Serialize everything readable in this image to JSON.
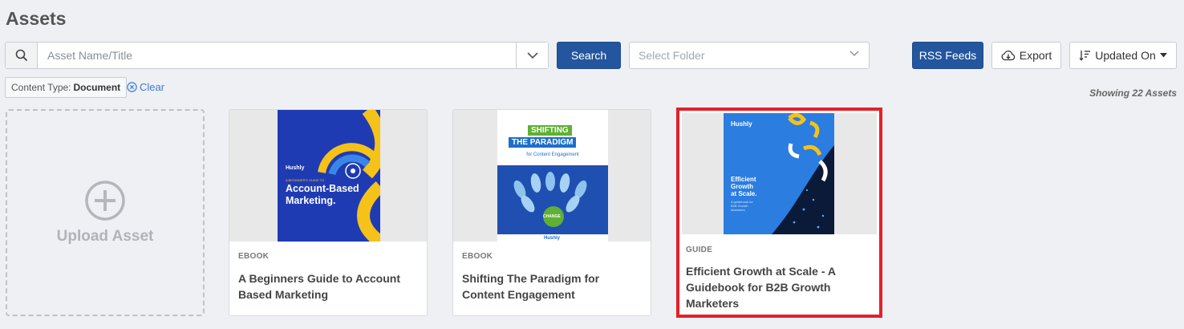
{
  "page": {
    "title": "Assets"
  },
  "search": {
    "placeholder": "Asset Name/Title",
    "button_label": "Search"
  },
  "folder_select": {
    "placeholder": "Select Folder"
  },
  "toolbar": {
    "rss_label": "RSS Feeds",
    "export_label": "Export",
    "sort_label": "Updated On"
  },
  "filters": {
    "chip_prefix": "Content Type:",
    "chip_value": "Document",
    "clear_label": "Clear"
  },
  "results": {
    "showing_text": "Showing 22 Assets"
  },
  "upload": {
    "label": "Upload Asset"
  },
  "assets": [
    {
      "type": "EBOOK",
      "title": "A Beginners Guide to Account Based Marketing",
      "cover": {
        "brand": "Hushly",
        "kicker": "A BEGINNER'S GUIDE TO",
        "line1": "Account-Based",
        "line2": "Marketing."
      }
    },
    {
      "type": "EBOOK",
      "title": "Shifting The Paradigm for Content Engagement",
      "cover": {
        "line1": "SHIFTING",
        "line2": "THE PARADIGM",
        "line3": "for Content Engagement",
        "pin_label": "CHANGE",
        "footer": "Hushly"
      }
    },
    {
      "type": "GUIDE",
      "title": "Efficient Growth at Scale - A Guidebook for B2B Growth Marketers",
      "cover": {
        "brand": "Hushly",
        "line1": "Efficient",
        "line2": "Growth",
        "line3": "at Scale.",
        "sub1": "A guidebook for",
        "sub2": "B2B Growth",
        "sub3": "Marketers"
      }
    }
  ],
  "colors": {
    "primary": "#23569e",
    "selection": "#e3202a",
    "background": "#eef0f4"
  }
}
